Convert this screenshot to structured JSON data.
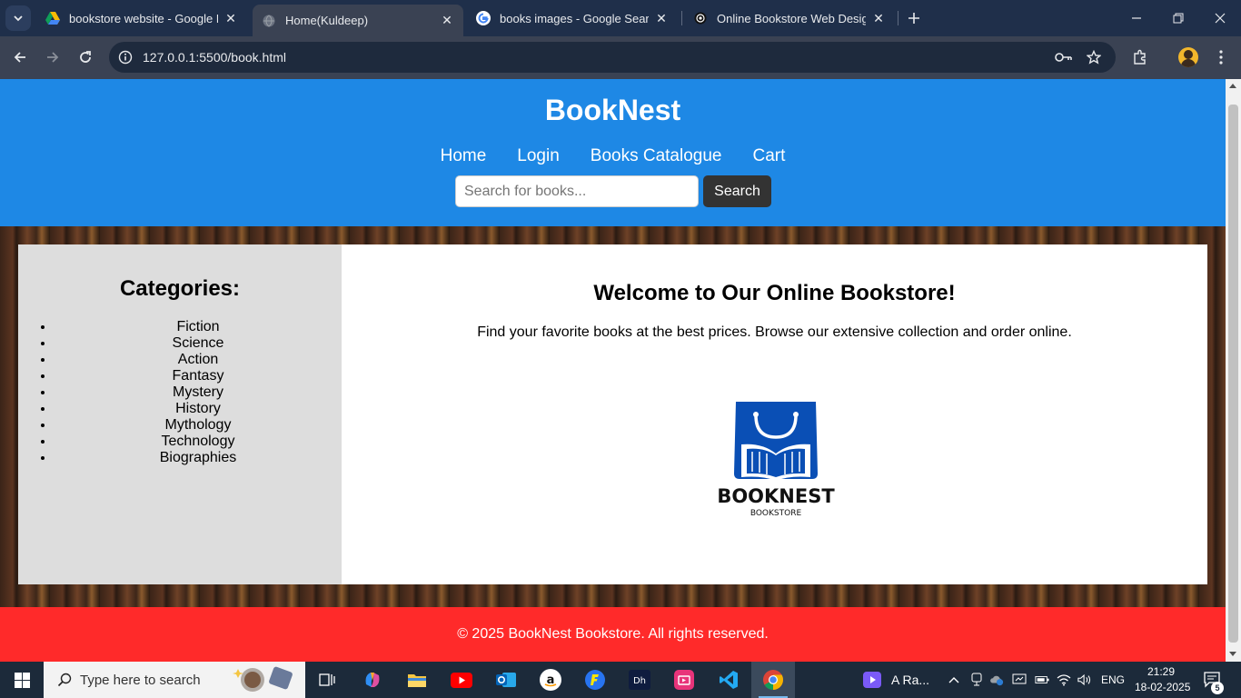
{
  "browser": {
    "tabs": [
      {
        "title": "bookstore website - Google Dr",
        "icon": "google-drive-icon"
      },
      {
        "title": "Home(Kuldeep)",
        "icon": "globe-icon",
        "active": true
      },
      {
        "title": "books images - Google Search",
        "icon": "google-icon"
      },
      {
        "title": "Online Bookstore Web Design",
        "icon": "chatgpt-icon"
      }
    ],
    "url": "127.0.0.1:5500/book.html"
  },
  "site": {
    "title": "BookNest",
    "nav": [
      "Home",
      "Login",
      "Books Catalogue",
      "Cart"
    ],
    "search": {
      "placeholder": "Search for books...",
      "button": "Search"
    },
    "sidebar": {
      "heading": "Categories:",
      "items": [
        "Fiction",
        "Science",
        "Action",
        "Fantasy",
        "Mystery",
        "History",
        "Mythology",
        "Technology",
        "Biographies"
      ]
    },
    "main": {
      "heading": "Welcome to Our Online Bookstore!",
      "text": "Find your favorite books at the best prices. Browse our extensive collection and order online.",
      "logo_name": "BOOKNEST",
      "logo_sub": "BOOKSTORE"
    },
    "footer": "© 2025 BookNest Bookstore. All rights reserved."
  },
  "taskbar": {
    "search_placeholder": "Type here to search",
    "media_label": "A Ra...",
    "lang": "ENG",
    "time": "21:29",
    "date": "18-02-2025",
    "notification_count": "5"
  },
  "colors": {
    "header": "#1e88e5",
    "footer": "#ff2a2a",
    "sidebar": "#dddddd",
    "logo_blue": "#0a4fb5"
  }
}
